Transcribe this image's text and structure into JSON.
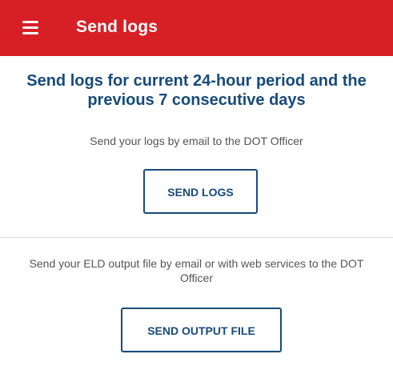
{
  "topbar": {
    "title": "Send logs",
    "menu_icon": "menu-icon",
    "background_color": "#d71f26"
  },
  "main": {
    "headline": "Send logs for current 24-hour period and the previous 7 consecutive days",
    "logs_description": "Send your logs by email to the DOT Officer",
    "send_logs_label": "SEND LOGS",
    "output_description": "Send your ELD output file by email or with web services to the DOT Officer",
    "send_output_file_label": "SEND OUTPUT FILE"
  },
  "colors": {
    "accent": "#174b7a",
    "text_secondary": "#555555"
  }
}
